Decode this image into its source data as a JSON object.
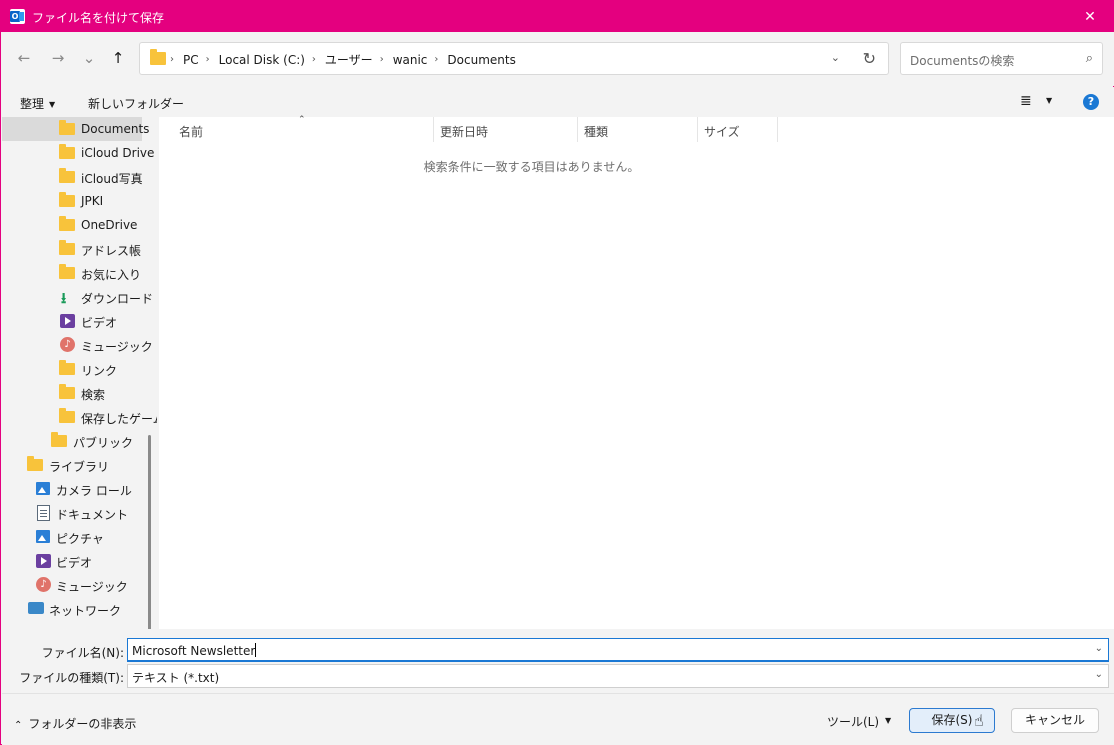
{
  "window": {
    "title": "ファイル名を付けて保存",
    "close": "✕",
    "accent": "#e4007f"
  },
  "nav": {
    "back": "←",
    "forward": "→",
    "recent": "⌄",
    "up": "↑",
    "crumbs": [
      "PC",
      "Local Disk (C:)",
      "ユーザー",
      "wanic",
      "Documents"
    ],
    "search_placeholder": "Documentsの検索"
  },
  "cmdbar": {
    "organize": "整理",
    "new_folder": "新しいフォルダー",
    "help": "?"
  },
  "sidebar": {
    "items": [
      {
        "label": "Documents",
        "icon": "folder-icon"
      },
      {
        "label": "iCloud Drive",
        "icon": "folder-icon"
      },
      {
        "label": "iCloud写真",
        "icon": "folder-icon"
      },
      {
        "label": "JPKI",
        "icon": "folder-icon"
      },
      {
        "label": "OneDrive",
        "icon": "folder-icon"
      },
      {
        "label": "アドレス帳",
        "icon": "folder-icon"
      },
      {
        "label": "お気に入り",
        "icon": "folder-icon"
      },
      {
        "label": "ダウンロード",
        "icon": "download-icon"
      },
      {
        "label": "ビデオ",
        "icon": "video-icon"
      },
      {
        "label": "ミュージック",
        "icon": "music-icon"
      },
      {
        "label": "リンク",
        "icon": "folder-icon"
      },
      {
        "label": "検索",
        "icon": "folder-icon"
      },
      {
        "label": "保存したゲーム",
        "icon": "folder-icon"
      },
      {
        "label": "パブリック",
        "icon": "folder-icon"
      },
      {
        "label": "ライブラリ",
        "icon": "folder-icon"
      },
      {
        "label": "カメラ ロール",
        "icon": "picture-icon"
      },
      {
        "label": "ドキュメント",
        "icon": "document-icon"
      },
      {
        "label": "ピクチャ",
        "icon": "picture-icon"
      },
      {
        "label": "ビデオ",
        "icon": "video-icon"
      },
      {
        "label": "ミュージック",
        "icon": "music-icon"
      },
      {
        "label": "ネットワーク",
        "icon": "network-icon"
      }
    ]
  },
  "columns": {
    "name": "名前",
    "modified": "更新日時",
    "type": "種類",
    "size": "サイズ"
  },
  "content": {
    "empty_message": "検索条件に一致する項目はありません。"
  },
  "fields": {
    "filename_label": "ファイル名(N):",
    "filename_value": "Microsoft Newsletter",
    "filetype_label": "ファイルの種類(T):",
    "filetype_value": "テキスト (*.txt)"
  },
  "footer": {
    "hide_folders": "フォルダーの非表示",
    "tools": "ツール(L)",
    "save": "保存(S)",
    "cancel": "キャンセル"
  }
}
